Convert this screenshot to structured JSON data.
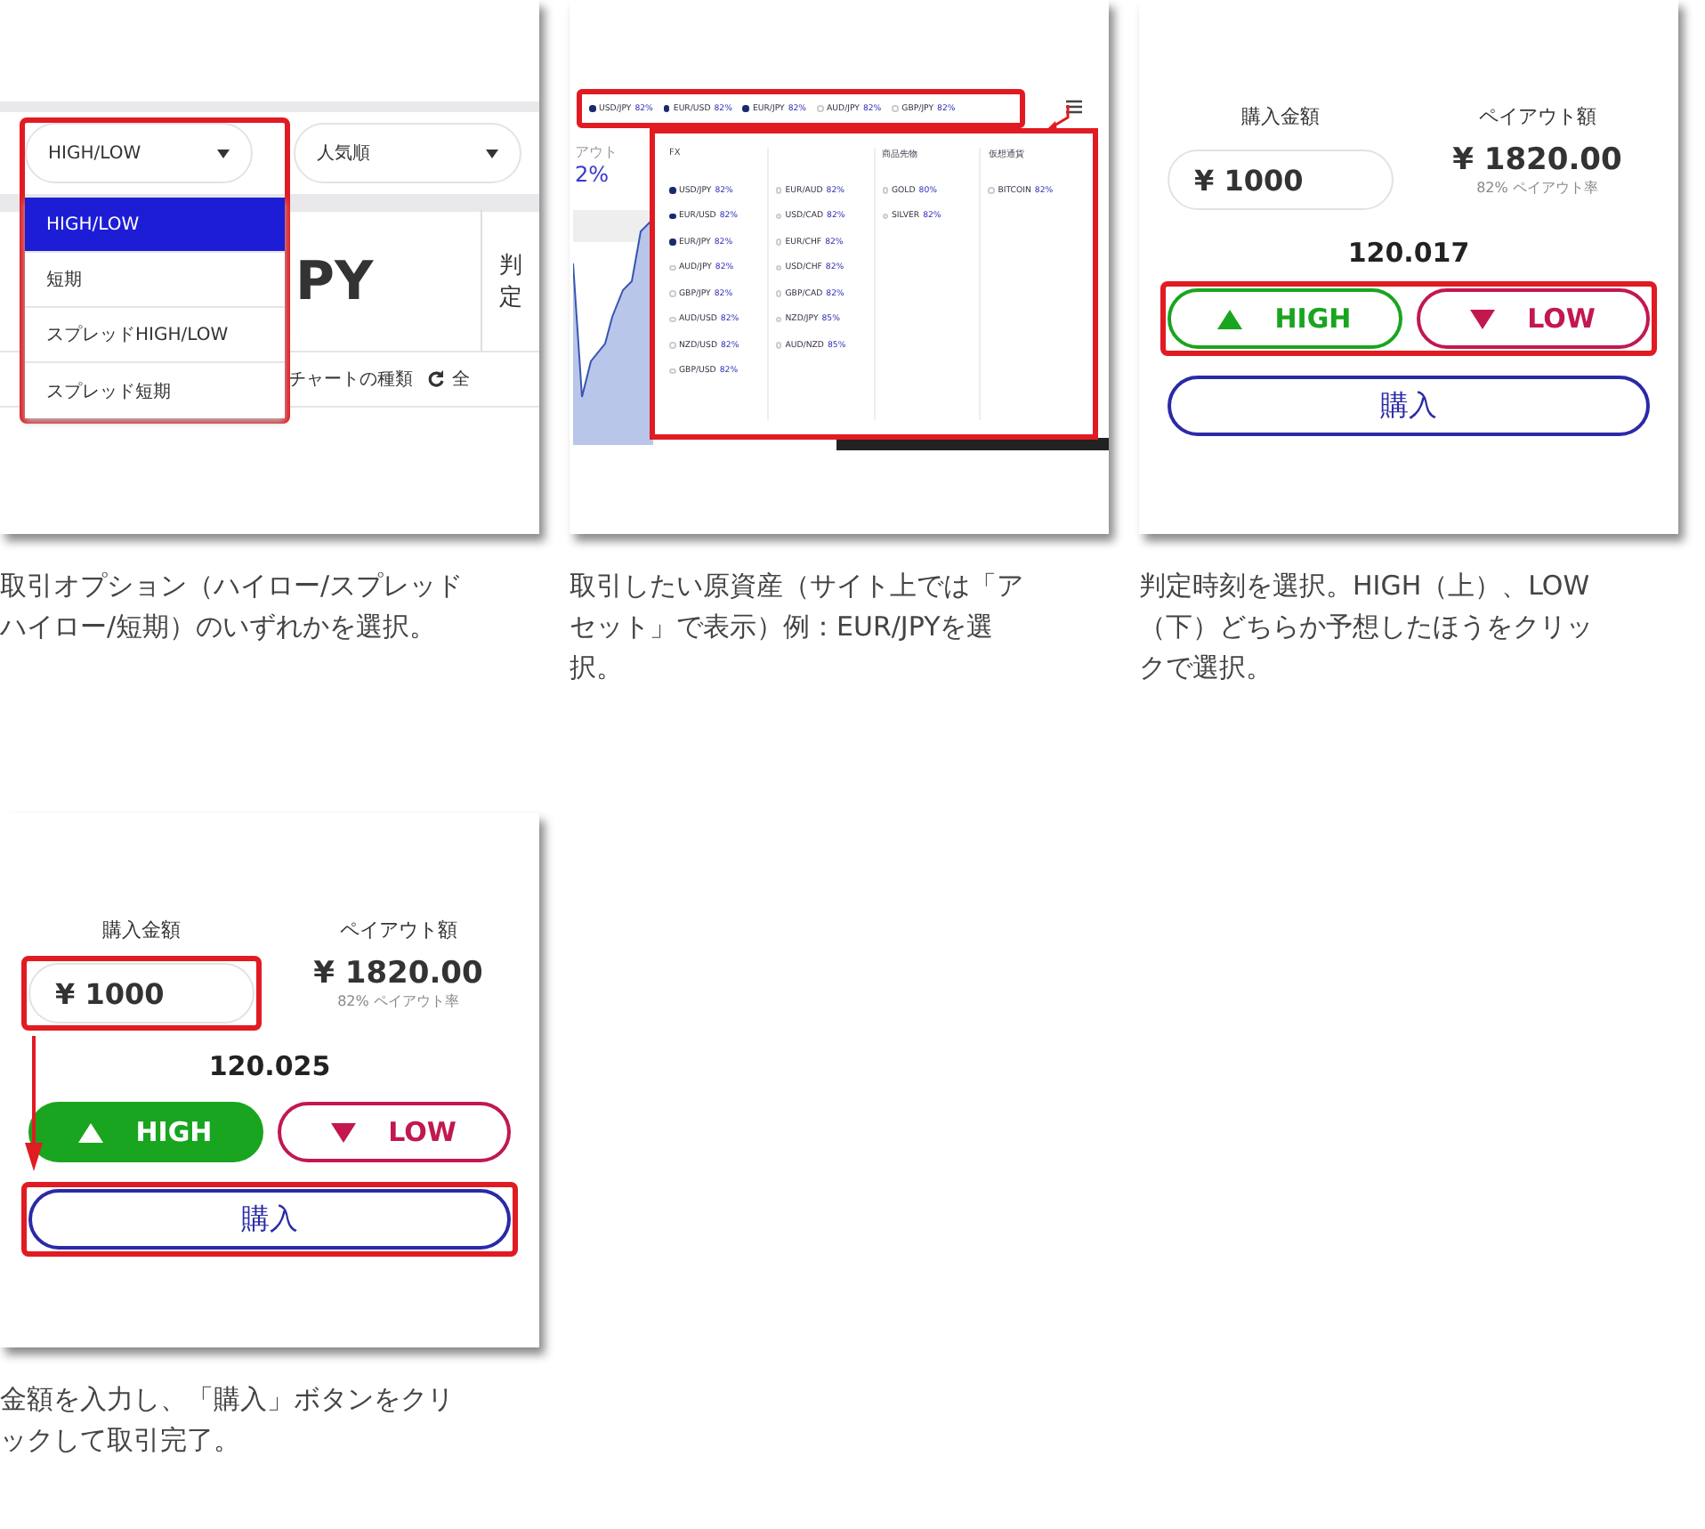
{
  "steps": [
    {
      "kind": "type-select",
      "caption": "取引オプション（ハイロー/スプレッドハイロー/短期）のいずれかを選択。",
      "selects": [
        {
          "value": "HIGH/LOW"
        },
        {
          "value": "人気順"
        }
      ],
      "menu": [
        {
          "label": "HIGH/LOW",
          "selected": true
        },
        {
          "label": "短期",
          "selected": false
        },
        {
          "label": "スプレッドHIGH/LOW",
          "selected": false
        },
        {
          "label": "スプレッド短期",
          "selected": false
        }
      ],
      "pair_fragment": "PY",
      "judge_label": "判定",
      "toolbar": [
        "チャートの種類",
        "全"
      ]
    },
    {
      "kind": "asset-select",
      "caption": "取引したい原資産（サイト上では「アセット」で表示）例：EUR/JPYを選択。",
      "tabs": [
        {
          "label": "USD/JPY",
          "rate": "82%",
          "favorite": true
        },
        {
          "label": "EUR/USD",
          "rate": "82%",
          "favorite": true
        },
        {
          "label": "EUR/JPY",
          "rate": "82%",
          "favorite": true
        },
        {
          "label": "AUD/JPY",
          "rate": "82%",
          "favorite": false
        },
        {
          "label": "GBP/JPY",
          "rate": "82%",
          "favorite": false
        }
      ],
      "side_fragments": [
        "アウト",
        "2%"
      ],
      "columns": [
        {
          "title": "FX",
          "items": [
            {
              "label": "USD/JPY",
              "rate": "82%",
              "favorite": true
            },
            {
              "label": "EUR/USD",
              "rate": "82%",
              "favorite": true
            },
            {
              "label": "EUR/JPY",
              "rate": "82%",
              "favorite": true
            },
            {
              "label": "AUD/JPY",
              "rate": "82%",
              "favorite": false
            },
            {
              "label": "GBP/JPY",
              "rate": "82%",
              "favorite": false
            },
            {
              "label": "AUD/USD",
              "rate": "82%",
              "favorite": false
            },
            {
              "label": "NZD/USD",
              "rate": "82%",
              "favorite": false
            },
            {
              "label": "GBP/USD",
              "rate": "82%",
              "favorite": false
            }
          ]
        },
        {
          "items": [
            {
              "label": "EUR/AUD",
              "rate": "82%",
              "favorite": false
            },
            {
              "label": "USD/CAD",
              "rate": "82%",
              "favorite": false
            },
            {
              "label": "EUR/CHF",
              "rate": "82%",
              "favorite": false
            },
            {
              "label": "USD/CHF",
              "rate": "82%",
              "favorite": false
            },
            {
              "label": "GBP/CAD",
              "rate": "82%",
              "favorite": false
            },
            {
              "label": "NZD/JPY",
              "rate": "85%",
              "favorite": false
            },
            {
              "label": "AUD/NZD",
              "rate": "85%",
              "favorite": false
            }
          ]
        },
        {
          "title": "商品先物",
          "items": [
            {
              "label": "GOLD",
              "rate": "80%",
              "favorite": false
            },
            {
              "label": "SILVER",
              "rate": "82%",
              "favorite": false
            }
          ]
        },
        {
          "title": "仮想通貨",
          "items": [
            {
              "label": "BITCOIN",
              "rate": "82%",
              "favorite": false
            }
          ]
        }
      ]
    },
    {
      "kind": "trade",
      "highlight_amount": false,
      "highlight_direction": true,
      "highlight_buy": false,
      "caption": "判定時刻を選択。HIGH（上）、LOW（下）どちらか予想したほうをクリックで選択。",
      "amount_label": "購入金額",
      "amount": "¥ 1000",
      "payout_label": "ペイアウト額",
      "payout": "¥ 1820.00",
      "payout_rate": "82% ペイアウト率",
      "price": "120.017",
      "high": {
        "label": "HIGH",
        "selected": false
      },
      "low": {
        "label": "LOW",
        "selected": false
      },
      "buy": "購入"
    },
    {
      "kind": "trade",
      "highlight_amount": true,
      "highlight_direction": false,
      "highlight_buy": true,
      "caption": "金額を入力し、「購入」ボタンをクリックして取引完了。",
      "amount_label": "購入金額",
      "amount": "¥ 1000",
      "payout_label": "ペイアウト額",
      "payout": "¥ 1820.00",
      "payout_rate": "82% ペイアウト率",
      "price": "120.025",
      "high": {
        "label": "HIGH",
        "selected": true
      },
      "low": {
        "label": "LOW",
        "selected": false
      },
      "buy": "購入"
    }
  ]
}
